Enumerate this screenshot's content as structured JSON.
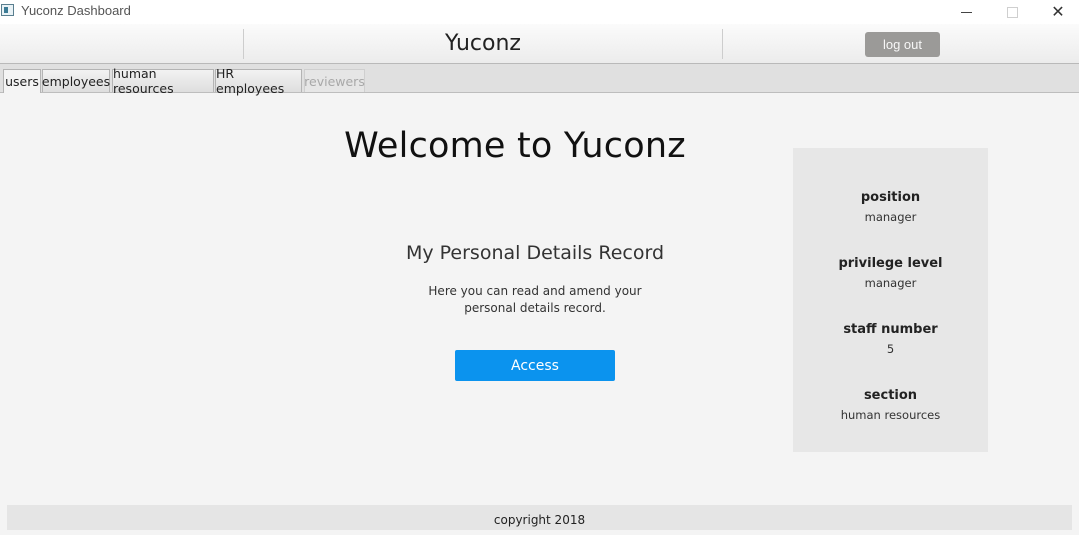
{
  "window": {
    "title": "Yuconz Dashboard",
    "minimize": "",
    "maximize": "",
    "close": "✕"
  },
  "header": {
    "brand": "Yuconz",
    "logout_label": "log out"
  },
  "tabs": [
    {
      "label": "users",
      "active": true,
      "disabled": false
    },
    {
      "label": "employees",
      "active": false,
      "disabled": false
    },
    {
      "label": "human resources",
      "active": false,
      "disabled": false
    },
    {
      "label": "HR employees",
      "active": false,
      "disabled": false
    },
    {
      "label": "reviewers",
      "active": false,
      "disabled": true
    }
  ],
  "main": {
    "welcome": "Welcome to Yuconz",
    "record_title": "My Personal Details Record",
    "record_desc_line1": "Here you can read and amend your",
    "record_desc_line2": "personal details record.",
    "access_label": "Access"
  },
  "info": {
    "position_label": "position",
    "position_value": "manager",
    "privilege_label": "privilege level",
    "privilege_value": "manager",
    "staff_label": "staff number",
    "staff_value": "5",
    "section_label": "section",
    "section_value": "human resources"
  },
  "footer": {
    "copyright": "copyright 2018"
  },
  "colors": {
    "accent": "#0b93ee",
    "logout_bg": "#9b9a98",
    "panel_bg": "#e7e7e7",
    "page_bg": "#f4f4f4"
  }
}
